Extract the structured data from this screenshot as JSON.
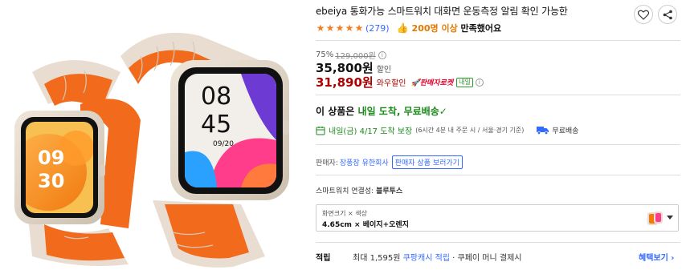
{
  "product": {
    "brand": "ebeiya",
    "title": "통화가능 스마트워치 대화면 운동측정 알림 확인 가능한"
  },
  "rating": {
    "stars": 5,
    "review_count": "(279)",
    "satisfaction_count": "200명 이상",
    "satisfaction_text": "만족했어요"
  },
  "price": {
    "discount_rate": "75%",
    "original_price": "129,000원",
    "sale_price": "35,800원",
    "sale_label": "할인",
    "wow_price": "31,890원",
    "wow_label": "와우할인",
    "rocket_badge": "판매자로켓",
    "tomorrow_badge": "내일"
  },
  "shipping": {
    "prefix": "이 상품은 ",
    "highlight": "내일 도착, 무료배송",
    "check": "✓"
  },
  "delivery": {
    "date": "내일(금) 4/17 도착 보장",
    "note": "(6시간 4분 내 주문 시 / 서울·경기 기준)",
    "free_shipping": "무료배송"
  },
  "seller": {
    "label": "판매자:",
    "name": "장풍장 유한회사",
    "link_label": "판매자 상품 보러가기"
  },
  "connectivity": {
    "label": "스마트워치 연결성: ",
    "value": "블루투스"
  },
  "option": {
    "label": "화면크기 × 색상",
    "value": "4.65cm × 베이지+오렌지"
  },
  "points": {
    "title": "적립",
    "desc_prefix": "최대 1,595원 ",
    "cash_label": "쿠팡캐시 적립",
    "desc_suffix": " · 쿠페이 머니 결제시",
    "more_label": "혜택보기 ›"
  },
  "watch_display": {
    "left_time_hour": "09",
    "left_time_min": "30",
    "right_time_hour": "08",
    "right_time_min": "45",
    "right_date": "09/20"
  },
  "colors": {
    "accent_blue": "#346aff",
    "wow_red": "#ae0000",
    "star_orange": "#f57c1f",
    "delivery_green": "#1b8a1b",
    "band_orange": "#f26a1b",
    "band_beige": "#e8ddd0"
  },
  "icons": [
    "heart-icon",
    "share-icon",
    "star-icon",
    "thumbs-up-icon",
    "info-icon",
    "calendar-icon",
    "truck-icon",
    "caret-down-icon"
  ]
}
